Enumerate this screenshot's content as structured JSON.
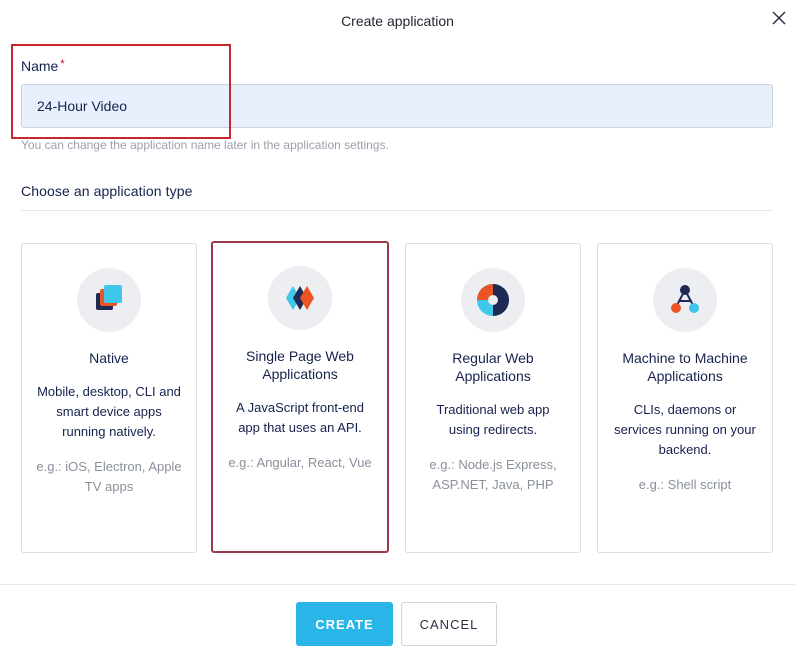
{
  "dialog": {
    "title": "Create application"
  },
  "name_field": {
    "label": "Name",
    "required_mark": "*",
    "value": "24-Hour Video",
    "hint": "You can change the application name later in the application settings."
  },
  "app_type": {
    "section_title": "Choose an application type",
    "selected": "spa",
    "cards": [
      {
        "id": "native",
        "icon": "native-stack-icon",
        "title": "Native",
        "description": "Mobile, desktop, CLI and smart device apps running natively.",
        "examples": "e.g.: iOS, Electron, Apple TV apps"
      },
      {
        "id": "spa",
        "icon": "spa-diamond-icon",
        "title": "Single Page Web Applications",
        "description": "A JavaScript front-end app that uses an API.",
        "examples": "e.g.: Angular, React, Vue"
      },
      {
        "id": "regular",
        "icon": "regular-web-icon",
        "title": "Regular Web Applications",
        "description": "Traditional web app using redirects.",
        "examples": "e.g.: Node.js Express, ASP.NET, Java, PHP"
      },
      {
        "id": "m2m",
        "icon": "machine-to-machine-icon",
        "title": "Machine to Machine Applications",
        "description": "CLIs, daemons or services running on your backend.",
        "examples": "e.g.: Shell script"
      }
    ]
  },
  "footer": {
    "create_label": "CREATE",
    "cancel_label": "CANCEL"
  },
  "colors": {
    "accent": "#29b5e8",
    "selected_border": "#9c3847",
    "highlight_border": "#c9252c",
    "input_background": "#e8f0fe"
  }
}
